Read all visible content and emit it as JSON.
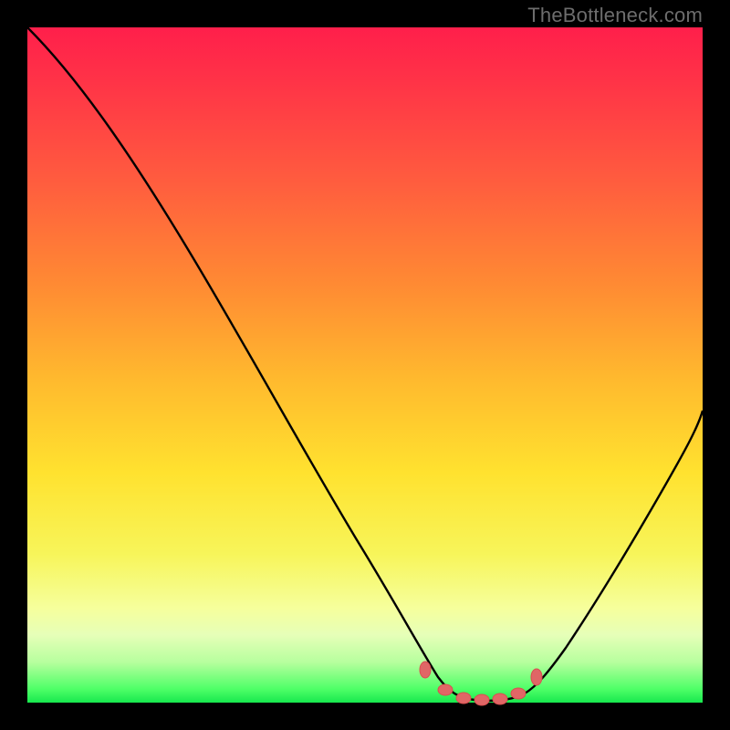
{
  "watermark": "TheBottleneck.com",
  "colors": {
    "frame": "#000000",
    "gradient_top": "#ff1f4b",
    "gradient_mid": "#ffe22f",
    "gradient_bottom": "#17e84e",
    "curve": "#000000",
    "beads": "#e06666"
  },
  "chart_data": {
    "type": "line",
    "title": "",
    "xlabel": "",
    "ylabel": "",
    "xlim": [
      0,
      100
    ],
    "ylim": [
      0,
      100
    ],
    "x": [
      0,
      4,
      8,
      12,
      16,
      20,
      24,
      28,
      32,
      36,
      40,
      44,
      48,
      52,
      56,
      58,
      60,
      62,
      64,
      66,
      68,
      70,
      72,
      74,
      76,
      80,
      84,
      88,
      92,
      96,
      100
    ],
    "values": [
      100,
      95,
      90,
      84,
      78,
      72,
      66,
      60,
      54,
      48,
      42,
      36,
      30,
      24,
      17,
      12,
      7,
      4,
      2,
      1,
      0.5,
      0.5,
      0.5,
      1,
      2,
      5,
      10,
      16,
      24,
      33,
      43
    ],
    "beads_x": [
      58.5,
      62,
      65,
      68,
      71,
      73.5,
      76
    ],
    "beads_y": [
      4.5,
      1.5,
      0.8,
      0.6,
      0.8,
      1.5,
      4.5
    ],
    "note": "y≈0 at the trough around x≈66–72; beads mark the flat bottom segment"
  }
}
